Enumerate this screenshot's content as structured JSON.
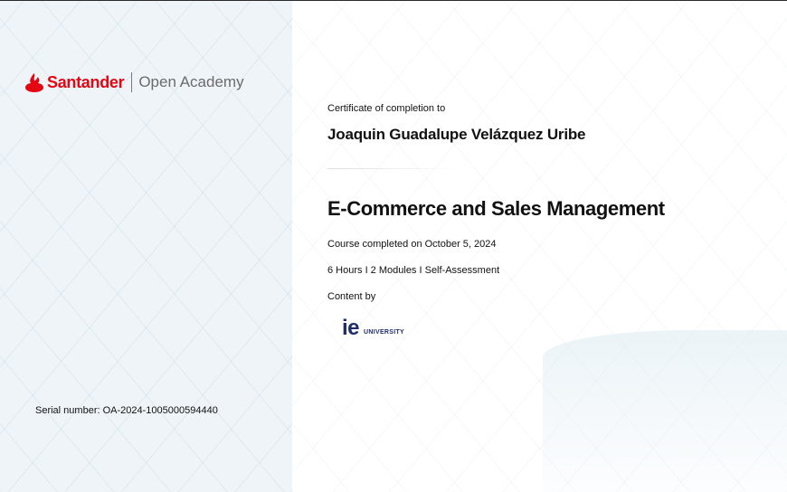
{
  "brand": {
    "name": "Santander",
    "product": "Open Academy",
    "color": "#e30613"
  },
  "certificate": {
    "label": "Certificate of completion to",
    "recipient": "Joaquin Guadalupe Velázquez Uribe",
    "course": "E-Commerce and Sales Management",
    "completed": "Course completed on October 5, 2024",
    "details": "6 Hours I 2 Modules I Self-Assessment",
    "content_by": "Content by",
    "serial": "Serial number: OA-2024-1005000594440"
  },
  "partner": {
    "letters": "ie",
    "word": "UNIVERSITY",
    "color": "#1d2d6b"
  }
}
